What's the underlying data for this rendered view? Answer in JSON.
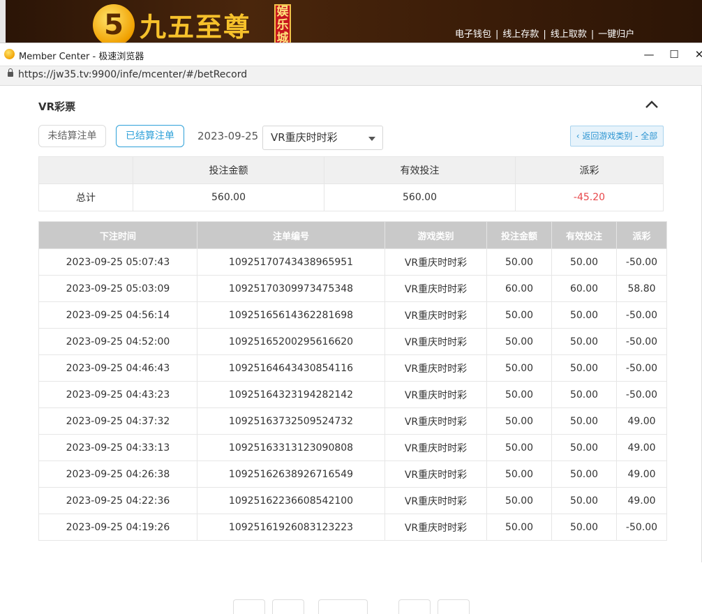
{
  "banner": {
    "logo_number": "5",
    "logo_text": "九五至尊",
    "logo_badge": "娱乐城",
    "nav": [
      "电子钱包",
      "线上存款",
      "线上取款",
      "一键归户"
    ],
    "nav_separator": "|"
  },
  "window": {
    "title": "Member Center - 极速浏览器",
    "url": "https://jw35.tv:9900/infe/mcenter/#/betRecord",
    "buttons": {
      "minimize": "—",
      "maximize": "☐",
      "close": "✕"
    }
  },
  "section": {
    "title": "VR彩票"
  },
  "filters": {
    "tab_unsettled": "未结算注单",
    "tab_settled": "已结算注单",
    "date": "2023-09-25",
    "game_select": "VR重庆时时彩",
    "back_button": "‹ 返回游戏类别 - 全部"
  },
  "summary": {
    "headers": [
      "",
      "投注金额",
      "有效投注",
      "派彩"
    ],
    "row_label": "总计",
    "bet_amount": "560.00",
    "valid_bet": "560.00",
    "payout": "-45.20"
  },
  "records": {
    "headers": [
      "下注时间",
      "注单编号",
      "游戏类别",
      "投注金额",
      "有效投注",
      "派彩"
    ],
    "rows": [
      {
        "time": "2023-09-25 05:07:43",
        "id": "10925170743438965951",
        "game": "VR重庆时时彩",
        "bet": "50.00",
        "valid": "50.00",
        "payout": "-50.00"
      },
      {
        "time": "2023-09-25 05:03:09",
        "id": "10925170309973475348",
        "game": "VR重庆时时彩",
        "bet": "60.00",
        "valid": "60.00",
        "payout": "58.80"
      },
      {
        "time": "2023-09-25 04:56:14",
        "id": "10925165614362281698",
        "game": "VR重庆时时彩",
        "bet": "50.00",
        "valid": "50.00",
        "payout": "-50.00"
      },
      {
        "time": "2023-09-25 04:52:00",
        "id": "10925165200295616620",
        "game": "VR重庆时时彩",
        "bet": "50.00",
        "valid": "50.00",
        "payout": "-50.00"
      },
      {
        "time": "2023-09-25 04:46:43",
        "id": "10925164643430854116",
        "game": "VR重庆时时彩",
        "bet": "50.00",
        "valid": "50.00",
        "payout": "-50.00"
      },
      {
        "time": "2023-09-25 04:43:23",
        "id": "10925164323194282142",
        "game": "VR重庆时时彩",
        "bet": "50.00",
        "valid": "50.00",
        "payout": "-50.00"
      },
      {
        "time": "2023-09-25 04:37:32",
        "id": "10925163732509524732",
        "game": "VR重庆时时彩",
        "bet": "50.00",
        "valid": "50.00",
        "payout": "49.00"
      },
      {
        "time": "2023-09-25 04:33:13",
        "id": "10925163313123090808",
        "game": "VR重庆时时彩",
        "bet": "50.00",
        "valid": "50.00",
        "payout": "49.00"
      },
      {
        "time": "2023-09-25 04:26:38",
        "id": "10925162638926716549",
        "game": "VR重庆时时彩",
        "bet": "50.00",
        "valid": "50.00",
        "payout": "49.00"
      },
      {
        "time": "2023-09-25 04:22:36",
        "id": "10925162236608542100",
        "game": "VR重庆时时彩",
        "bet": "50.00",
        "valid": "50.00",
        "payout": "49.00"
      },
      {
        "time": "2023-09-25 04:19:26",
        "id": "10925161926083123223",
        "game": "VR重庆时时彩",
        "bet": "50.00",
        "valid": "50.00",
        "payout": "-50.00"
      }
    ]
  },
  "colors": {
    "accent": "#2da0d8",
    "negative": "#e8474a",
    "header_gray": "#c9c9c9"
  }
}
